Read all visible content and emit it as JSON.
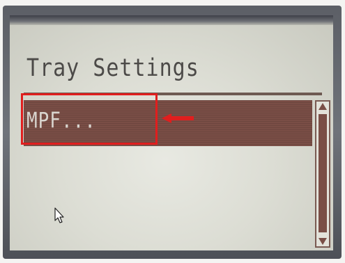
{
  "panel": {
    "title": "Tray Settings",
    "selected_item": "MPF..."
  },
  "icons": {
    "scroll_up": "triangle-up-icon",
    "scroll_down": "triangle-down-icon",
    "annotation_arrow": "left-arrow-icon",
    "cursor": "mouse-pointer-icon"
  },
  "colors": {
    "highlight": "#7a4e46",
    "annotation": "#e01e1e",
    "lcd_background": "#dcddd4"
  }
}
